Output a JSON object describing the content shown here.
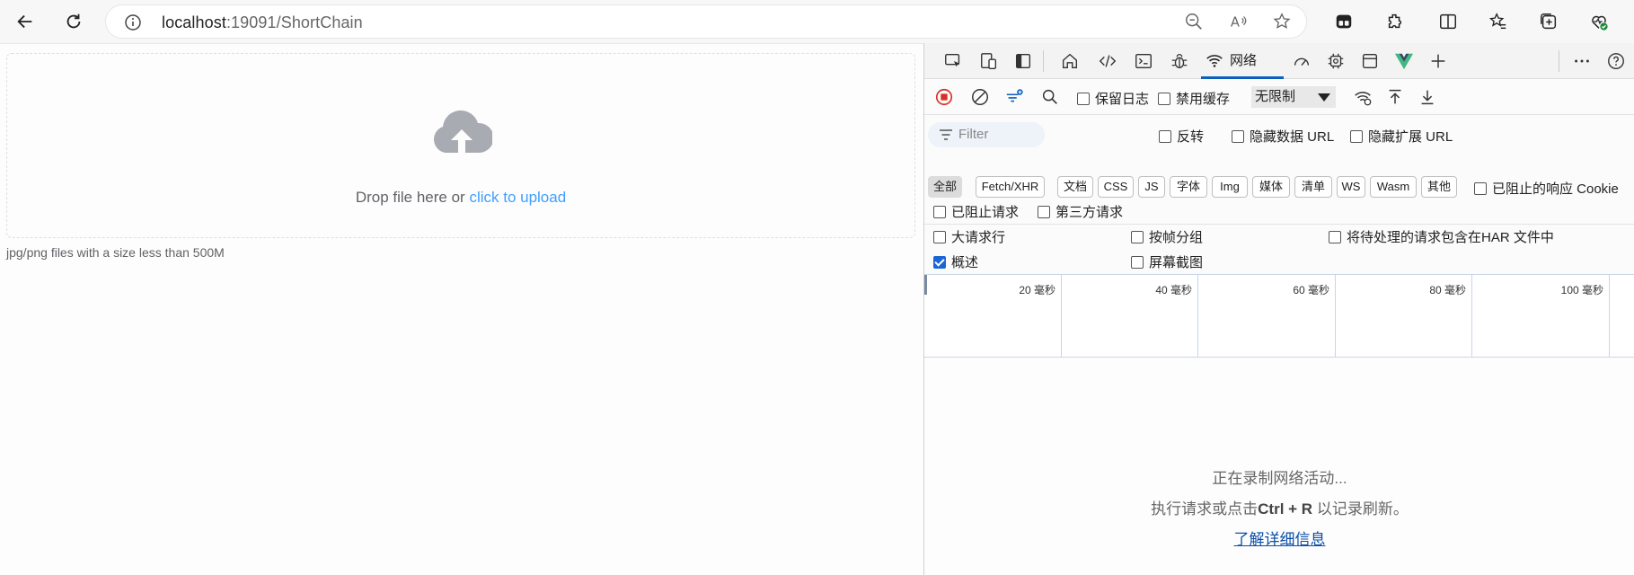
{
  "browser": {
    "url_host": "localhost",
    "url_rest": ":19091/ShortChain",
    "icons": [
      "back-icon",
      "refresh-icon",
      "info-icon",
      "zoom-out-icon",
      "read-aloud-icon",
      "favorite-star-icon",
      "profile-icon",
      "extensions-icon",
      "split-screen-icon",
      "favorites-icon",
      "collections-icon",
      "browser-essentials-icon"
    ]
  },
  "upload": {
    "drop_text": "Drop file here or ",
    "drop_link": "click to upload",
    "tip": "jpg/png files with a size less than 500M"
  },
  "devtools": {
    "network_tab": "网络",
    "preserve_log": "保留日志",
    "disable_cache": "禁用缓存",
    "throttle": "无限制",
    "filter_placeholder": "Filter",
    "invert": "反转",
    "hide_data_urls": "隐藏数据 URL",
    "hide_ext_urls": "隐藏扩展 URL",
    "chips": [
      "全部",
      "Fetch/XHR",
      "文档",
      "CSS",
      "JS",
      "字体",
      "Img",
      "媒体",
      "清单",
      "WS",
      "Wasm",
      "其他"
    ],
    "blocked_cookies": "已阻止的响应 Cookie",
    "blocked_requests": "已阻止请求",
    "third_party": "第三方请求",
    "big_rows": "大请求行",
    "group_by_frame": "按帧分组",
    "har_pending": "将待处理的请求包含在HAR 文件中",
    "overview": "概述",
    "screenshots": "屏幕截图",
    "timeline_labels": [
      "20 毫秒",
      "40 毫秒",
      "60 毫秒",
      "80 毫秒",
      "100 毫秒"
    ],
    "empty_line1": "正在录制网络活动...",
    "empty_line2_pre": "执行请求或点击",
    "empty_line2_key": "Ctrl + R",
    "empty_line2_post": " 以记录刷新。",
    "empty_link": "了解详细信息"
  },
  "colors": {
    "link": "#409eff",
    "active_tab": "#0a5fc0",
    "checkbox": "#1a66d6",
    "record": "#d93025"
  }
}
